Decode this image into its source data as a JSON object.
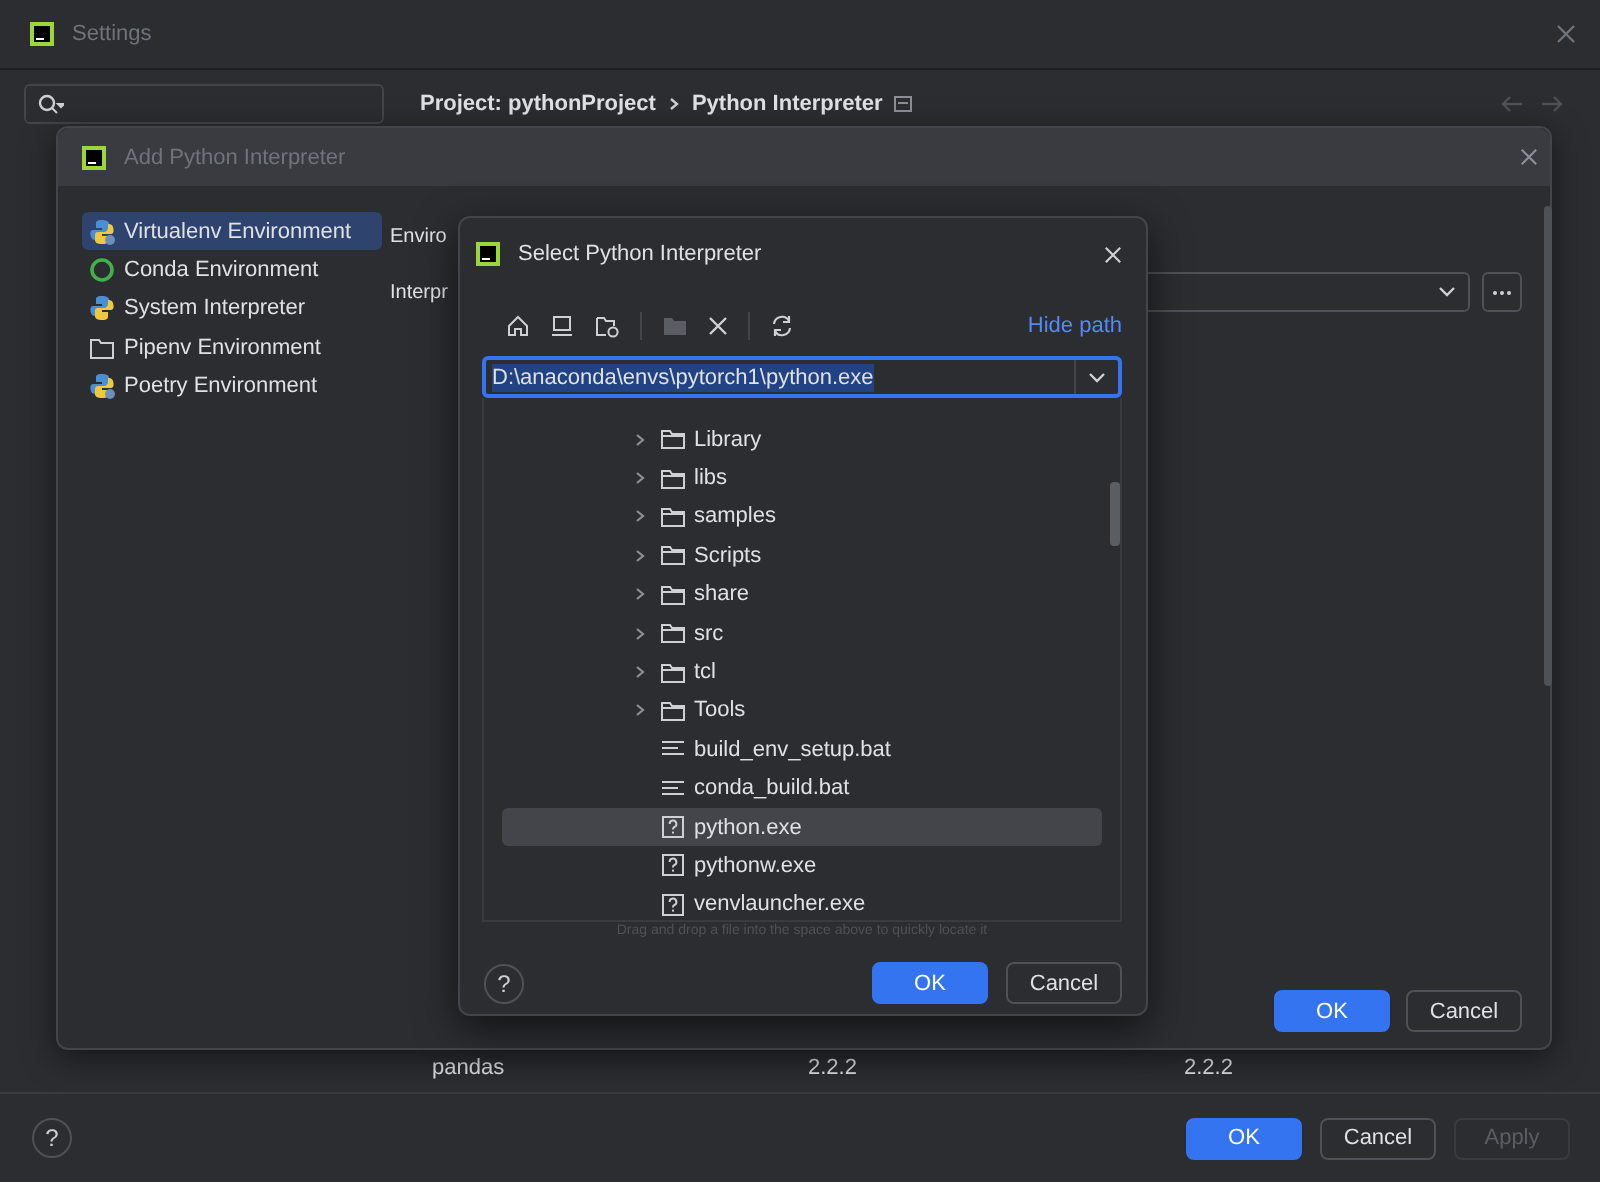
{
  "settings": {
    "title": "Settings",
    "help": "?",
    "breadcrumb": [
      "Project: pythonProject",
      "Python Interpreter"
    ],
    "package_row": [
      "pandas",
      "2.2.2",
      "2.2.2"
    ],
    "buttons": [
      {
        "label": "OK",
        "kind": "primary",
        "disabled": false
      },
      {
        "label": "Cancel",
        "kind": "secondary",
        "disabled": false
      },
      {
        "label": "Apply",
        "kind": "secondary",
        "disabled": true
      }
    ]
  },
  "add_dialog": {
    "title": "Add Python Interpreter",
    "environments": [
      {
        "label": "Virtualenv Environment",
        "kind": "virtualenv",
        "selected": true
      },
      {
        "label": "Conda Environment",
        "kind": "conda",
        "selected": false
      },
      {
        "label": "System Interpreter",
        "kind": "python",
        "selected": false
      },
      {
        "label": "Pipenv Environment",
        "kind": "pipenv",
        "selected": false
      },
      {
        "label": "Poetry Environment",
        "kind": "poetry",
        "selected": false
      }
    ],
    "field_labels": [
      "Enviro",
      "Interpr"
    ],
    "buttons": [
      {
        "label": "OK",
        "kind": "primary",
        "disabled": false
      },
      {
        "label": "Cancel",
        "kind": "secondary",
        "disabled": false
      }
    ]
  },
  "select_dialog": {
    "title": "Select Python Interpreter",
    "help": "?",
    "hide_path": "Hide path",
    "path": "D:\\anaconda\\envs\\pytorch1\\python.exe",
    "files": [
      {
        "name": "Library",
        "kind": "folder",
        "selected": false
      },
      {
        "name": "libs",
        "kind": "folder",
        "selected": false
      },
      {
        "name": "samples",
        "kind": "folder",
        "selected": false
      },
      {
        "name": "Scripts",
        "kind": "folder",
        "selected": false
      },
      {
        "name": "share",
        "kind": "folder",
        "selected": false
      },
      {
        "name": "src",
        "kind": "folder",
        "selected": false
      },
      {
        "name": "tcl",
        "kind": "folder",
        "selected": false
      },
      {
        "name": "Tools",
        "kind": "folder",
        "selected": false
      },
      {
        "name": "build_env_setup.bat",
        "kind": "text",
        "selected": false
      },
      {
        "name": "conda_build.bat",
        "kind": "text",
        "selected": false
      },
      {
        "name": "python.exe",
        "kind": "unknown",
        "selected": true
      },
      {
        "name": "pythonw.exe",
        "kind": "unknown",
        "selected": false
      },
      {
        "name": "venvlauncher.exe",
        "kind": "unknown",
        "selected": false
      }
    ],
    "hint": "Drag and drop a file into the space above to quickly locate it",
    "buttons": [
      {
        "label": "OK",
        "kind": "primary",
        "disabled": false
      },
      {
        "label": "Cancel",
        "kind": "secondary",
        "disabled": false
      }
    ]
  }
}
